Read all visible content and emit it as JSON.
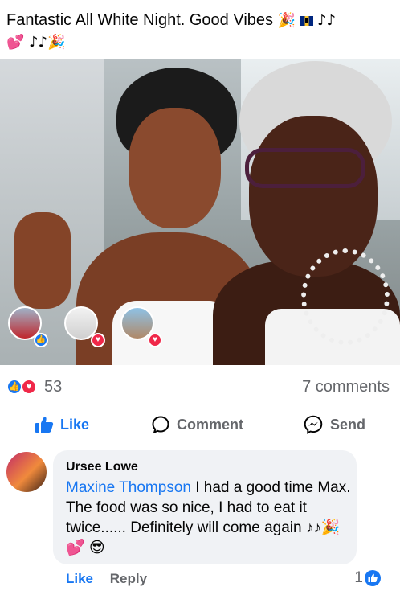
{
  "post": {
    "caption_text": "Fantastic All White Night. Good Vibes",
    "caption_emojis_1": "🎉",
    "caption_emojis_2": "♪♪",
    "caption_line2": "💕 ♪♪🎉"
  },
  "reactions": {
    "count": "53",
    "comments_label": "7 comments",
    "like_color": "#1877f2",
    "love_color": "#f02849"
  },
  "actions": {
    "like_label": "Like",
    "comment_label": "Comment",
    "send_label": "Send"
  },
  "comment": {
    "author": "Ursee Lowe",
    "mention": "Maxine Thompson",
    "text": " I had a good time Max.  The food was so nice, I had to eat it twice...... Definitely will come again ♪♪🎉💕 😎",
    "like_label": "Like",
    "reply_label": "Reply",
    "like_count": "1"
  }
}
